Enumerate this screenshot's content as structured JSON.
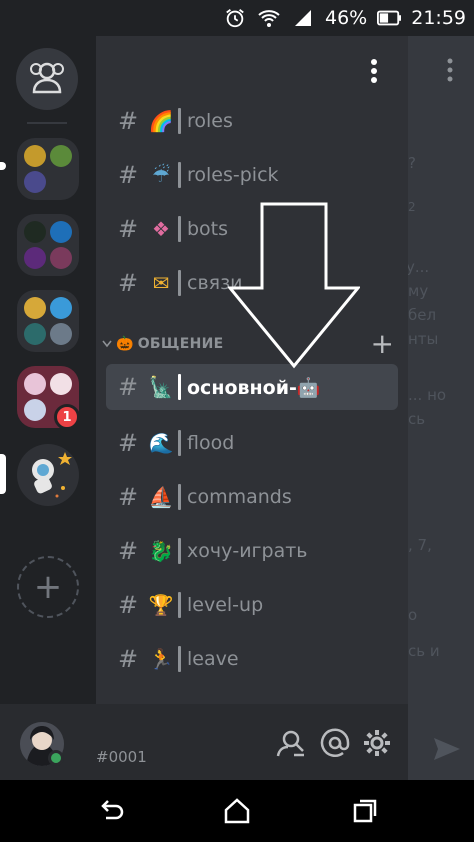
{
  "status_bar": {
    "battery": "46%",
    "time": "21:59",
    "icons": [
      "alarm-icon",
      "wifi-icon",
      "signal-icon",
      "battery-icon"
    ]
  },
  "server_rail": {
    "home_icon": "friends-icon",
    "unread_badge": "1",
    "add_server_icon": "+"
  },
  "channel_panel": {
    "menu_icon": "more-vertical-icon",
    "channels_top": [
      {
        "hash": "#",
        "emoji": "🌈",
        "label": "roles"
      },
      {
        "hash": "#",
        "emoji": "☔",
        "label": "roles-pick"
      },
      {
        "hash": "#",
        "emoji": "❖",
        "label": "bots"
      },
      {
        "hash": "#",
        "emoji": "✉",
        "label": "связи"
      }
    ],
    "category": {
      "emoji": "🎃",
      "label": "ОБЩЕНИЕ",
      "add": "+"
    },
    "channels_bottom": [
      {
        "hash": "#",
        "emoji": "🗽",
        "label": "основной-🤖",
        "active": true
      },
      {
        "hash": "#",
        "emoji": "🌊",
        "label": "flood"
      },
      {
        "hash": "#",
        "emoji": "⛵",
        "label": "commands"
      },
      {
        "hash": "#",
        "emoji": "🐉",
        "label": "хочу-играть"
      },
      {
        "hash": "#",
        "emoji": "🏆",
        "label": "level-up"
      },
      {
        "hash": "#",
        "emoji": "🏃",
        "label": "leave"
      }
    ]
  },
  "chat_peek": {
    "fragments": [
      "?",
      "2",
      "у...",
      "му",
      "бел",
      "нты",
      "... но",
      "сь",
      ", 7,",
      "о",
      "сь и"
    ]
  },
  "user_panel": {
    "discriminator": "#0001",
    "icons": [
      "search-members-icon",
      "mention-icon",
      "settings-icon"
    ]
  },
  "colors": {
    "rail_bg": "#202225",
    "panel_bg": "#2f3136",
    "chat_bg": "#36393f",
    "userbar_bg": "#292b2f",
    "active_bg": "#42464d",
    "online": "#3ba55d",
    "badge": "#ed4245"
  }
}
